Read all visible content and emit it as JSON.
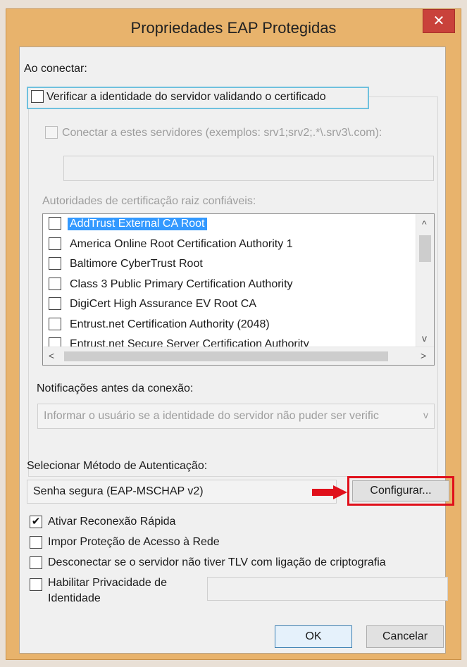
{
  "window": {
    "title": "Propriedades EAP Protegidas",
    "close_glyph": "✕"
  },
  "connect": {
    "heading": "Ao conectar:",
    "verify_label": "Verificar a identidade do servidor validando o certificado",
    "verify_checked": false,
    "servers_label": "Conectar a estes servidores (exemplos: srv1;srv2;.*\\.srv3\\.com):",
    "servers_value": "",
    "ca_label": "Autoridades de certificação raiz confiáveis:",
    "ca_items": [
      {
        "label": "AddTrust External CA Root",
        "selected": true
      },
      {
        "label": "America Online Root Certification Authority 1",
        "selected": false
      },
      {
        "label": "Baltimore CyberTrust Root",
        "selected": false
      },
      {
        "label": "Class 3 Public Primary Certification Authority",
        "selected": false
      },
      {
        "label": "DigiCert High Assurance EV Root CA",
        "selected": false
      },
      {
        "label": "Entrust.net Certification Authority (2048)",
        "selected": false
      },
      {
        "label": "Entrust.net Secure Server Certification Authority",
        "selected": false
      }
    ],
    "scroll_up": "^",
    "scroll_down": "v",
    "scroll_left": "<",
    "scroll_right": ">",
    "notifications_label": "Notificações antes da conexão:",
    "notifications_value": "Informar o usuário se a identidade do servidor não puder ser verific",
    "dropdown_glyph": "v"
  },
  "auth": {
    "heading": "Selecionar Método de Autenticação:",
    "method_value": "Senha segura (EAP-MSCHAP v2)",
    "configure_label": "Configurar...",
    "highlight_color": "#e0101b"
  },
  "options": {
    "fast_reconnect": {
      "label": "Ativar Reconexão Rápida",
      "checked": true,
      "check_glyph": "✔"
    },
    "nap": {
      "label": "Impor Proteção de Acesso à Rede",
      "checked": false
    },
    "disconnect_tlv": {
      "label": "Desconectar se o servidor não tiver TLV com ligação de criptografia",
      "checked": false
    },
    "privacy_line1": "Habilitar Privacidade de",
    "privacy_line2": "Identidade",
    "privacy_checked": false,
    "privacy_value": ""
  },
  "footer": {
    "ok_label": "OK",
    "cancel_label": "Cancelar"
  }
}
